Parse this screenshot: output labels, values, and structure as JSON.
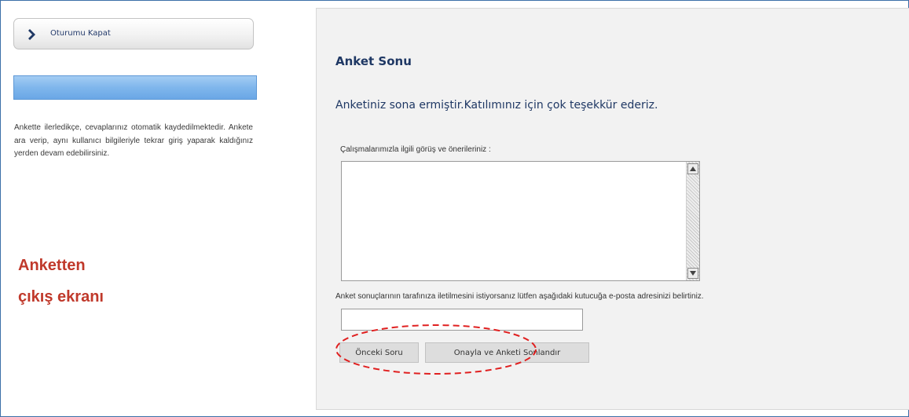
{
  "sidebar": {
    "logout_label": "Oturumu Kapat",
    "info_text": "Ankette ilerledikçe, cevaplarınız otomatik kaydedilmektedir. Ankete ara verip, aynı kullanıcı bilgileriyle tekrar giriş yaparak kaldığınız yerden devam edebilirsiniz.",
    "annotation_line1": "Anketten",
    "annotation_line2": "çıkış ekranı"
  },
  "main": {
    "title": "Anket Sonu",
    "thanks_message": "Anketiniz sona ermiştir.Katılımınız için çok teşekkür ederiz.",
    "comments_label": "Çalışmalarımızla ilgili görüş ve önerileriniz :",
    "comments_value": "",
    "email_label": "Anket sonuçlarının tarafınıza iletilmesini istiyorsanız lütfen aşağıdaki kutucuğa e-posta adresinizi belirtiniz.",
    "email_value": "",
    "prev_button": "Önceki Soru",
    "finish_button": "Onayla ve Anketi Sonlandır"
  },
  "colors": {
    "frame_border": "#3c6fa8",
    "blue_bar": "#7fb6ec",
    "panel_bg": "#f2f2f2",
    "title_text": "#1f3864",
    "annotation_red": "#c0392b"
  },
  "icons": {
    "logout": "chevron-right-icon",
    "scroll_up": "arrow-up-icon",
    "scroll_down": "arrow-down-icon"
  }
}
